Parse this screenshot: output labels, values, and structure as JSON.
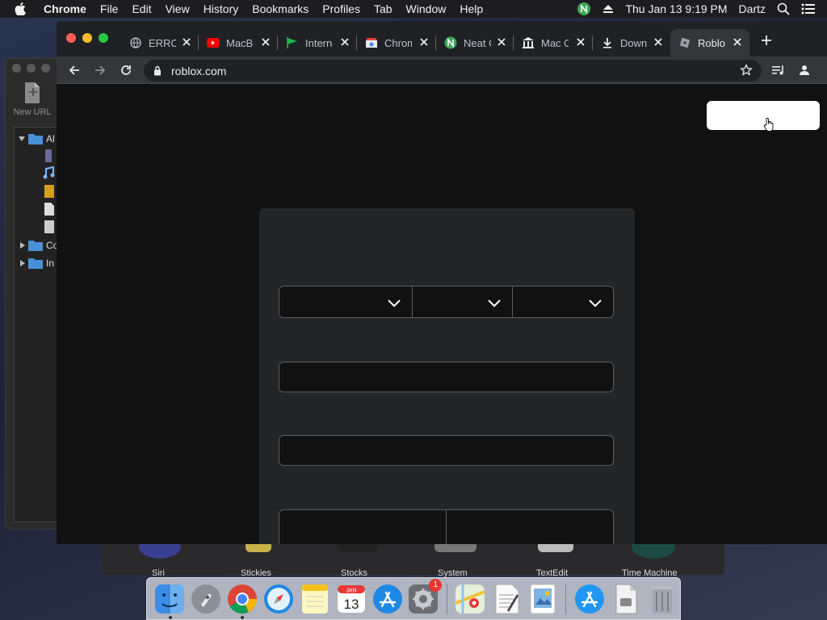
{
  "menubar": {
    "app_name": "Chrome",
    "items": [
      "File",
      "Edit",
      "View",
      "History",
      "Bookmarks",
      "Profiles",
      "Tab",
      "Window",
      "Help"
    ],
    "clock": "Thu Jan 13  9:19 PM",
    "user": "Dartz",
    "status_icons": [
      "norton-icon",
      "eject-icon",
      "spotlight-icon",
      "control-center-icon"
    ]
  },
  "background_window": {
    "new_url_label": "New URL",
    "tree": [
      "Al",
      "Co",
      "In"
    ]
  },
  "dock_shelf": {
    "labels": [
      "Siri",
      "Stickies",
      "Stocks",
      "System",
      "TextEdit",
      "Time Machine"
    ]
  },
  "dock": {
    "items": [
      {
        "name": "finder-icon",
        "running": true
      },
      {
        "name": "launchpad-icon",
        "running": false
      },
      {
        "name": "chrome-icon",
        "running": true
      },
      {
        "name": "safari-icon",
        "running": false
      },
      {
        "name": "notes-icon",
        "running": false
      },
      {
        "name": "calendar-icon",
        "running": false,
        "month": "JAN",
        "day": "13"
      },
      {
        "name": "app-store-icon",
        "running": false
      },
      {
        "name": "system-preferences-icon",
        "running": false,
        "badge": "1"
      },
      {
        "name": "maps-icon",
        "running": false
      },
      {
        "name": "textedit-icon",
        "running": false
      },
      {
        "name": "preview-icon",
        "running": false
      },
      {
        "name": "app-store-downloads-icon",
        "running": false
      },
      {
        "name": "document-icon",
        "running": false
      },
      {
        "name": "trash-icon",
        "running": false
      }
    ]
  },
  "chrome": {
    "tabs": [
      {
        "title": "ERROR",
        "favicon": "globe-icon",
        "active": false
      },
      {
        "title": "MacBook",
        "favicon": "youtube-icon",
        "active": false
      },
      {
        "title": "Internet",
        "favicon": "flag-icon",
        "active": false
      },
      {
        "title": "Chrome",
        "favicon": "chrome-store-icon",
        "active": false
      },
      {
        "title": "Neat Chrome",
        "favicon": "neat-icon",
        "active": false
      },
      {
        "title": "Mac OS",
        "favicon": "museum-icon",
        "active": false
      },
      {
        "title": "Downloads",
        "favicon": "download-icon",
        "active": false
      },
      {
        "title": "Roblox",
        "favicon": "roblox-icon",
        "active": true
      }
    ],
    "url": "roblox.com"
  },
  "page": {
    "login_button_label": "",
    "birthday": {
      "month": "",
      "day": "",
      "year": ""
    },
    "username": {
      "value": "",
      "placeholder": ""
    },
    "password": {
      "value": "",
      "placeholder": ""
    }
  },
  "colors": {
    "tab_active": "#35363a",
    "tabstrip": "#202124",
    "page_bg": "#111112",
    "card_bg": "#232527",
    "close_red": "#ff5f57",
    "min_yellow": "#febc2e",
    "max_green": "#28c840"
  }
}
